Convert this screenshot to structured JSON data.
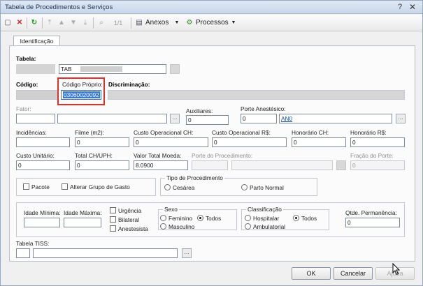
{
  "window": {
    "title": "Tabela de Procedimentos e Serviços"
  },
  "toolbar": {
    "page": "1/1",
    "anexos": "Anexos",
    "processos": "Processos"
  },
  "tabs": {
    "identificacao": "Identificação"
  },
  "form": {
    "tabela_label": "Tabela:",
    "tabela_value": "TAB",
    "codigo_label": "Código:",
    "codigo_proprio_label": "Código Próprio:",
    "codigo_proprio_value": "03060020092",
    "discriminacao_label": "Discriminação:",
    "fator_label": "Fator:",
    "auxiliares_label": "Auxiliares:",
    "auxiliares_value": "0",
    "porte_anest_label": "Porte Anestésico:",
    "porte_anest_value": "0",
    "porte_anest_code": "AN0",
    "incidencias_label": "Incidências:",
    "filme_label": "Filme (m2):",
    "filme_value": "0",
    "custo_op_ch_label": "Custo Operacional CH:",
    "custo_op_ch_value": "0",
    "custo_op_rs_label": "Custo Operacional R$:",
    "custo_op_rs_value": "0",
    "honorario_ch_label": "Honorário CH:",
    "honorario_ch_value": "0",
    "honorario_rs_label": "Honorário R$:",
    "honorario_rs_value": "0",
    "custo_unit_label": "Custo Unitário:",
    "custo_unit_value": "0",
    "total_ch_label": "Total CH/UPH:",
    "total_ch_value": "0",
    "valor_total_label": "Valor Total Moeda:",
    "valor_total_value": "8.0900",
    "porte_proc_label": "Porte do Procedimento:",
    "fracao_label": "Fração do Porte:",
    "fracao_value": "0",
    "pacote_label": "Pacote",
    "alterar_grupo_label": "Alterar Grupo de Gasto",
    "tipo_proc_label": "Tipo de Procedimento",
    "cesarea_label": "Cesárea",
    "parto_label": "Parto Normal",
    "idade_min_label": "Idade Mínima:",
    "idade_max_label": "Idade Máxima:",
    "urgencia_label": "Urgência",
    "bilateral_label": "Bilateral",
    "anestesista_label": "Anestesista",
    "sexo_label": "Sexo",
    "feminino_label": "Feminino",
    "todos_label": "Todos",
    "masculino_label": "Masculino",
    "classificacao_label": "Classificação",
    "hospitalar_label": "Hospitalar",
    "ambulatorial_label": "Ambulatorial",
    "qtde_label": "Qtde. Permanência:",
    "qtde_value": "0",
    "tiss_label": "Tabela TISS:"
  },
  "buttons": {
    "ok": "OK",
    "cancelar": "Cancelar",
    "ajuda": "Ajuda"
  }
}
